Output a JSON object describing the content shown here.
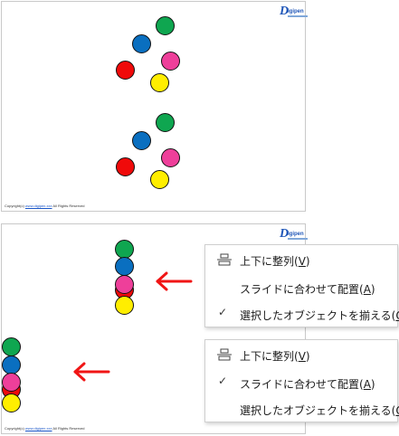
{
  "brand": {
    "logo_initial": "D",
    "logo_rest": "igipen"
  },
  "copyright": {
    "prefix": "Copyright(c)",
    "link": "www.digipen.xxx",
    "suffix": "All Rights Reserved"
  },
  "colors": {
    "green": "#0fa650",
    "blue": "#0a6fc0",
    "pink": "#ee3f9a",
    "red": "#f00a0a",
    "yellow": "#ffee00",
    "arrow": "#f01515"
  },
  "menu_top": {
    "items": [
      {
        "icon": "align-middle-icon",
        "label": "上下に整列",
        "accel": "V",
        "checked": false
      },
      {
        "icon": "",
        "label": "スライドに合わせて配置",
        "accel": "A",
        "checked": false
      },
      {
        "icon": "",
        "label": "選択したオブジェクトを揃える",
        "accel": "O",
        "checked": true
      }
    ]
  },
  "menu_bottom": {
    "items": [
      {
        "icon": "align-middle-icon",
        "label": "上下に整列",
        "accel": "V",
        "checked": false
      },
      {
        "icon": "",
        "label": "スライドに合わせて配置",
        "accel": "A",
        "checked": true
      },
      {
        "icon": "",
        "label": "選択したオブジェクトを揃える",
        "accel": "O",
        "checked": false
      }
    ]
  }
}
